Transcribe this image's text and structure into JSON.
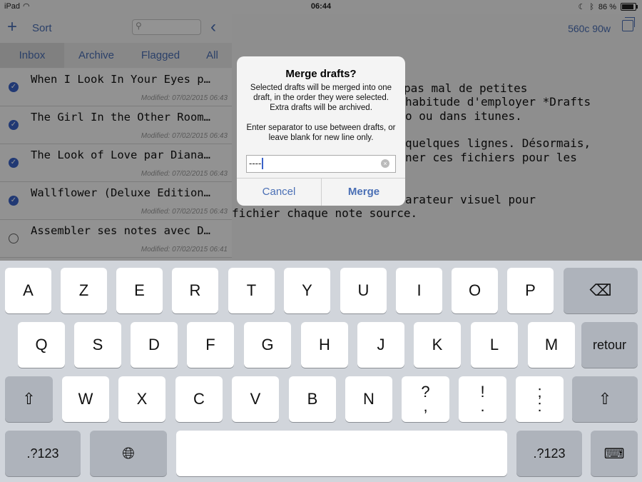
{
  "status": {
    "device": "iPad",
    "time": "06:44",
    "battery": "86 %"
  },
  "sidebar": {
    "add_icon": "+",
    "sort_label": "Sort",
    "back_icon": "‹",
    "tabs": [
      "Inbox",
      "Archive",
      "Flagged",
      "All"
    ],
    "drafts": [
      {
        "title": "When I Look In Your Eyes p…",
        "modified": "Modified: 07/02/2015 06:43",
        "selected": true
      },
      {
        "title": "The Girl In the Other Room…",
        "modified": "Modified: 07/02/2015 06:43",
        "selected": true
      },
      {
        "title": "The Look of Love par Diana…",
        "modified": "Modified: 07/02/2015 06:43",
        "selected": true
      },
      {
        "title": "Wallflower (Deluxe Edition…",
        "modified": "Modified: 07/02/2015 06:43",
        "selected": true
      },
      {
        "title": "Assembler ses notes avec D…",
        "modified": "Modified: 07/02/2015 06:41",
        "selected": false
      }
    ]
  },
  "editor": {
    "count": "560c 90w",
    "lines": [
      "pas mal de petites",
      "habitude d'employer *Drafts",
      "o ou dans itunes.",
      "quelques lignes. Désormais,",
      "ner ces fichiers pour les",
      "arateur visuel pour",
      "fichier chaque note source."
    ]
  },
  "alert": {
    "title": "Merge drafts?",
    "message": "Selected drafts will be merged into one draft, in the order they were selected. Extra drafts will be archived.",
    "message2": "Enter separator to use between drafts, or leave blank for new line only.",
    "field_value": "----",
    "cancel": "Cancel",
    "merge": "Merge"
  },
  "keyboard": {
    "row1": [
      "A",
      "Z",
      "E",
      "R",
      "T",
      "Y",
      "U",
      "I",
      "O",
      "P"
    ],
    "row2": [
      "Q",
      "S",
      "D",
      "F",
      "G",
      "H",
      "J",
      "K",
      "L",
      "M"
    ],
    "row3": [
      "W",
      "X",
      "C",
      "V",
      "B",
      "N"
    ],
    "row3_punct": [
      [
        "?",
        ","
      ],
      [
        "!",
        "."
      ],
      [
        ";",
        ":"
      ]
    ],
    "return_label": "retour",
    "numbers_label": ".?123"
  }
}
